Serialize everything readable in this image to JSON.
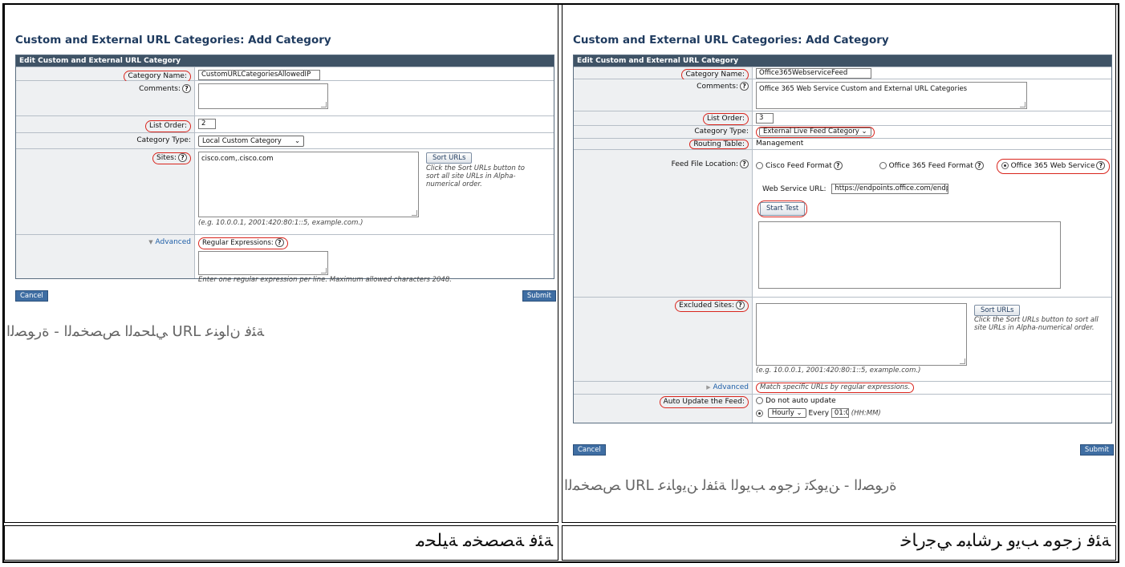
{
  "left": {
    "heading": "Custom and External URL Categories: Add Category",
    "panel_title": "Edit Custom and External URL Category",
    "category_name_label": "Category Name:",
    "category_name_value": "CustomURLCategoriesAllowedIP",
    "comments_label": "Comments:",
    "list_order_label": "List Order:",
    "list_order_value": "2",
    "category_type_label": "Category Type:",
    "category_type_value": "Local Custom Category",
    "sites_label": "Sites:",
    "sites_value": "cisco.com,.cisco.com",
    "sort_urls_button": "Sort URLs",
    "sort_urls_hint": "Click the Sort URLs button to sort all site URLs in Alpha-numerical order.",
    "sites_example": "(e.g. 10.0.0.1, 2001:420:80:1::5, example.com.)",
    "advanced_label": "Advanced",
    "regex_label": "Regular Expressions:",
    "regex_hint": "Enter one regular expression per line. Maximum allowed characters 2048.",
    "cancel_button": "Cancel",
    "submit_button": "Submit",
    "caption": "ﺔﺌﻓ ﻥﺍﻮﻨﻋ URL ﻲﻠﺤﻤﻟﺍ ﺺﺼﺨﻤﻟﺍ - ﺓﺭﻮﺼﻟﺍ",
    "footer": "ﺔﺌﻓ ﺔﺼﺼﺨﻣ ﺔﻴﻠﺤﻣ"
  },
  "right": {
    "heading": "Custom and External URL Categories: Add Category",
    "panel_title": "Edit Custom and External URL Category",
    "category_name_label": "Category Name:",
    "category_name_value": "Office365WebserviceFeed",
    "comments_label": "Comments:",
    "comments_value": "Office 365 Web Service Custom and External URL Categories",
    "list_order_label": "List Order:",
    "list_order_value": "3",
    "category_type_label": "Category Type:",
    "category_type_value": "External Live Feed Category",
    "routing_table_label": "Routing Table:",
    "routing_table_value": "Management",
    "feed_file_location_label": "Feed File Location:",
    "feed_options": [
      "Cisco Feed Format",
      "Office 365 Feed Format",
      "Office 365 Web Service"
    ],
    "web_service_url_label": "Web Service URL:",
    "web_service_url_value": "https://endpoints.office.com/endpoi",
    "start_test_button": "Start Test",
    "excluded_sites_label": "Excluded Sites:",
    "sort_urls_button": "Sort URLs",
    "sort_urls_hint": "Click the Sort URLs button to sort all site URLs in Alpha-numerical order.",
    "sites_example": "(e.g. 10.0.0.1, 2001:420:80:1::5, example.com.)",
    "advanced_label": "Advanced",
    "advanced_value": "Match specific URLs by regular expressions.",
    "auto_update_label": "Auto Update the Feed:",
    "no_auto_update": "Do not auto update",
    "hourly_value": "Hourly",
    "every_label": "Every",
    "every_value": "01:0",
    "hhmm_hint": "(HH:MM)",
    "cancel_button": "Cancel",
    "submit_button": "Submit",
    "caption": "ﺓﺭﻮﺼﻟﺍ - ﻦﻳﻮﻜﺗ ﺯﺟﻮﻣ ﺐﻳﻮﻟﺍ ﺔﺌﻔﻟ ﻦﻳﻭﺎﻨﻋ URL ﺺﺼﺨﻤﻟﺍ",
    "footer": "ﺔﺌﻓ ﺯﺟﻮﻣ ﺐﻳﻭ ﺮﺷﺎﺒﻣ ﻲﺟﺭﺎﺧ"
  },
  "colors": {
    "panel_header": "#3f5366",
    "highlight": "#d9251d",
    "heading": "#1f3b5f"
  }
}
